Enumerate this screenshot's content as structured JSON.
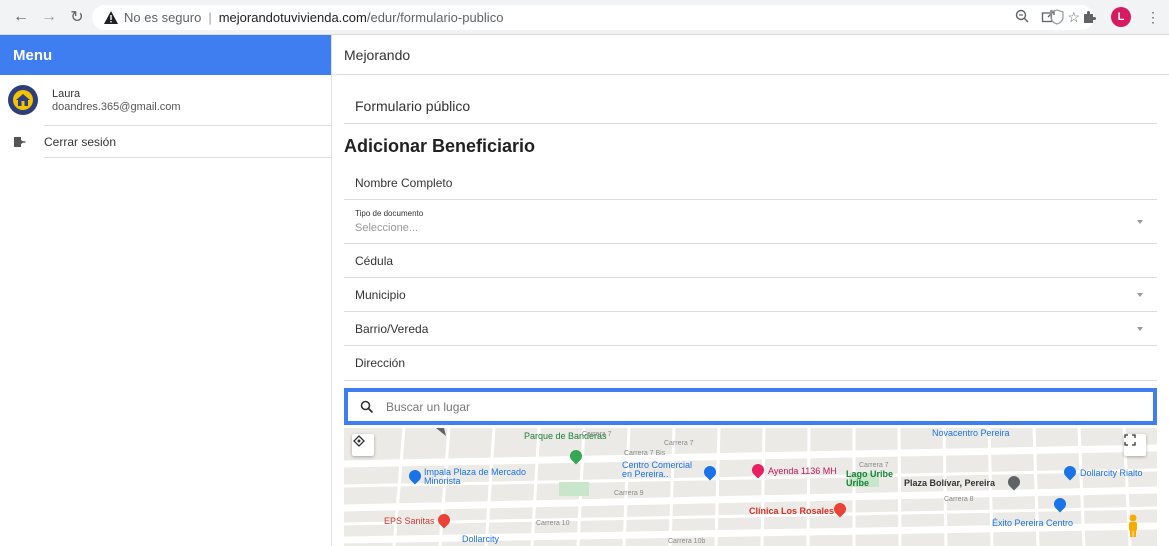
{
  "browser": {
    "security_label": "No es seguro",
    "url_host": "mejorandotuvivienda.com",
    "url_path": "/edur/formulario-publico",
    "profile_initial": "L"
  },
  "sidebar": {
    "title": "Menu",
    "user_name": "Laura",
    "user_email": "doandres.365@gmail.com",
    "logout_label": "Cerrar sesión"
  },
  "topbar": {
    "title": "Mejorando"
  },
  "card": {
    "title": "Formulario público"
  },
  "form": {
    "title": "Adicionar Beneficiario",
    "nombre_label": "Nombre Completo",
    "tipo_label": "Tipo de documento",
    "tipo_placeholder": "Seleccione...",
    "cedula_label": "Cédula",
    "municipio_label": "Municipio",
    "barrio_label": "Barrio/Vereda",
    "direccion_label": "Dirección",
    "search_placeholder": "Buscar un lugar"
  },
  "map": {
    "labels": {
      "parque": "Parque de Banderas",
      "carrera7a": "Carrera 7",
      "carrera7b": "Carrera 7",
      "carrera7c": "Carrera 7",
      "carrera7bis": "Carrera 7 Bis",
      "novacentro": "Novacentro Pereira",
      "impala": "Impala Plaza de Mercado Minorista",
      "centro_comercial": "Centro Comercial en Pereira..",
      "ayenda": "Ayenda 1136 MH",
      "lago": "Lago Uribe Uribe",
      "plaza_bolivar": "Plaza Bolívar, Pereira",
      "dollarcity_rialto": "Dollarcity Rialto",
      "carrera8": "Carrera 8",
      "carrera9": "Carrera 9",
      "eps": "EPS Sanitas",
      "clinica": "Clínica Los Rosales",
      "exito": "Éxito Pereira Centro",
      "dollarcity": "Dollarcity",
      "carrera10": "Carrera 10",
      "carrera10b": "Carrera 10b"
    }
  },
  "colors": {
    "accent": "#3e7ef0",
    "map_bg": "#eceae6"
  }
}
